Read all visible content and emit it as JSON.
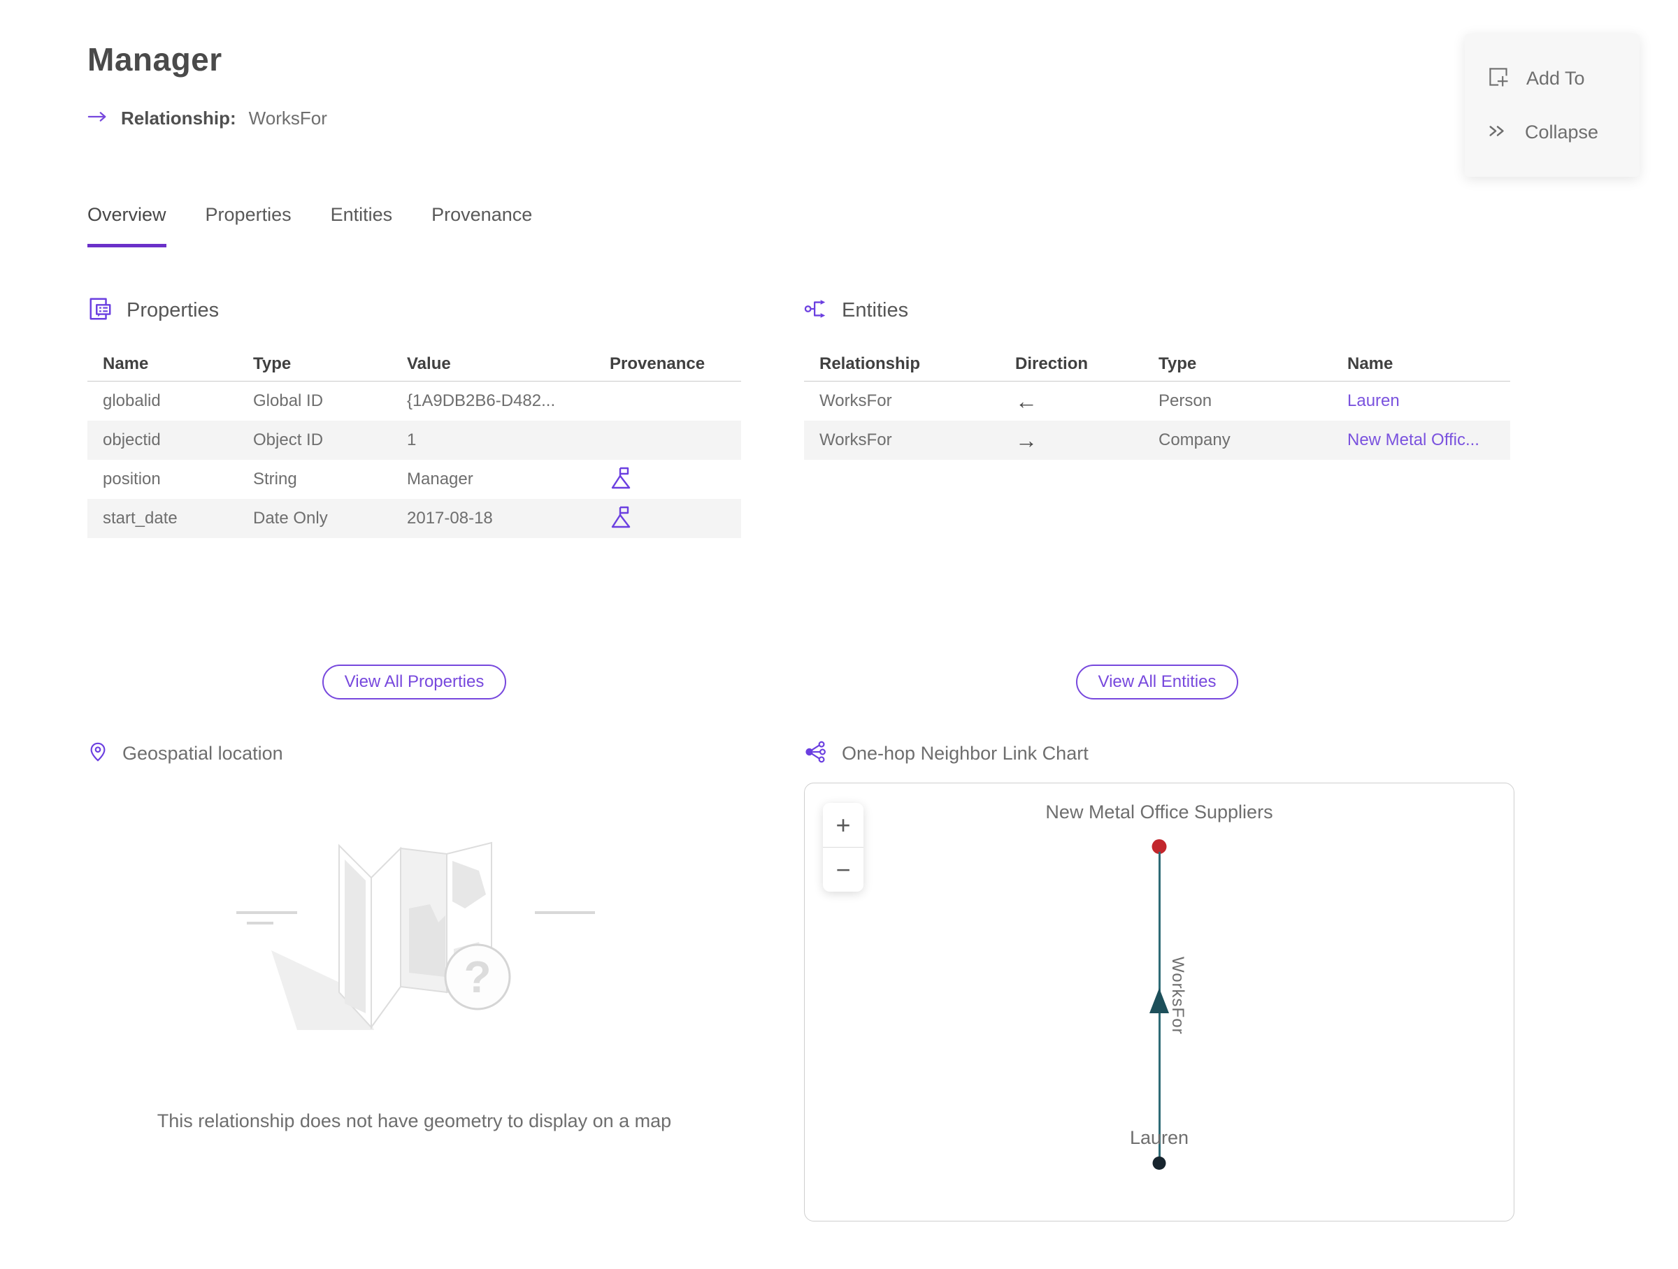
{
  "header": {
    "title": "Manager",
    "relationship_label": "Relationship:",
    "relationship_value": "WorksFor"
  },
  "action_panel": {
    "add_to_label": "Add To",
    "collapse_label": "Collapse"
  },
  "tabs": [
    {
      "label": "Overview",
      "active": true
    },
    {
      "label": "Properties",
      "active": false
    },
    {
      "label": "Entities",
      "active": false
    },
    {
      "label": "Provenance",
      "active": false
    }
  ],
  "properties_section": {
    "title": "Properties",
    "columns": [
      "Name",
      "Type",
      "Value",
      "Provenance"
    ],
    "rows": [
      {
        "name": "globalid",
        "type": "Global ID",
        "value": "{1A9DB2B6-D482...",
        "has_provenance": false
      },
      {
        "name": "objectid",
        "type": "Object ID",
        "value": "1",
        "has_provenance": false
      },
      {
        "name": "position",
        "type": "String",
        "value": "Manager",
        "has_provenance": true
      },
      {
        "name": "start_date",
        "type": "Date Only",
        "value": "2017-08-18",
        "has_provenance": true
      }
    ],
    "view_all_label": "View All Properties"
  },
  "entities_section": {
    "title": "Entities",
    "columns": [
      "Relationship",
      "Direction",
      "Type",
      "Name"
    ],
    "rows": [
      {
        "relationship": "WorksFor",
        "direction": "←",
        "type": "Person",
        "name": "Lauren"
      },
      {
        "relationship": "WorksFor",
        "direction": "→",
        "type": "Company",
        "name": "New Metal Offic..."
      }
    ],
    "view_all_label": "View All Entities"
  },
  "geospatial_section": {
    "title": "Geospatial location",
    "empty_message": "This relationship does not have geometry to display on a map"
  },
  "link_chart_section": {
    "title": "One-hop Neighbor Link Chart",
    "zoom_in_label": "+",
    "zoom_out_label": "−",
    "top_node": {
      "label": "New Metal Office Suppliers",
      "color": "#c2262c"
    },
    "bottom_node": {
      "label": "Lauren",
      "color": "#17242e"
    },
    "edge": {
      "label": "WorksFor",
      "color": "#2e6b76"
    }
  },
  "colors": {
    "accent_purple": "#7748dd",
    "icon_purple": "#6b3fe0",
    "tab_underline": "#6a30c9",
    "edge_teal": "#2e6b76",
    "arrow_teal": "#1d4f5a",
    "node_red": "#c2262c",
    "node_dark": "#17242e",
    "row_alt_bg": "#f4f4f4"
  }
}
